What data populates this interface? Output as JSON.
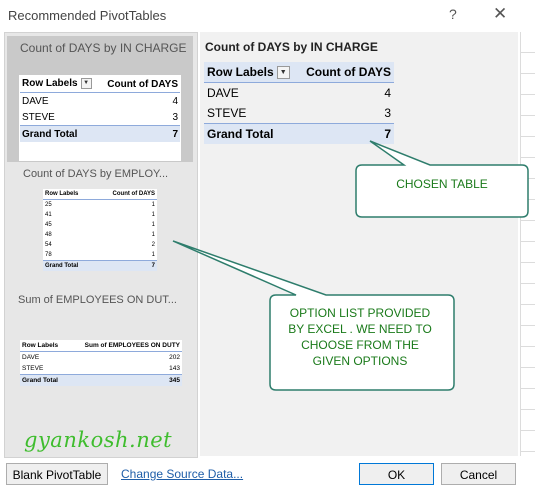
{
  "window": {
    "title": "Recommended PivotTables",
    "help": "?",
    "close": "✕"
  },
  "options": [
    {
      "title": "Count of DAYS by IN CHARGE",
      "headers": [
        "Row Labels",
        "Count of DAYS"
      ],
      "rows": [
        [
          "DAVE",
          "4"
        ],
        [
          "STEVE",
          "3"
        ]
      ],
      "total": [
        "Grand Total",
        "7"
      ]
    },
    {
      "title": "Count of DAYS by EMPLOY...",
      "headers": [
        "Row Labels",
        "Count of DAYS"
      ],
      "rows": [
        [
          "25",
          "1"
        ],
        [
          "41",
          "1"
        ],
        [
          "45",
          "1"
        ],
        [
          "48",
          "1"
        ],
        [
          "54",
          "2"
        ],
        [
          "78",
          "1"
        ]
      ],
      "total": [
        "Grand Total",
        "7"
      ]
    },
    {
      "title": "Sum of EMPLOYEES ON DUT...",
      "headers": [
        "Row Labels",
        "Sum of EMPLOYEES ON DUTY"
      ],
      "rows": [
        [
          "DAVE",
          "202"
        ],
        [
          "STEVE",
          "143"
        ]
      ],
      "total": [
        "Grand Total",
        "345"
      ]
    }
  ],
  "preview": {
    "title": "Count of DAYS by IN CHARGE",
    "headers": [
      "Row Labels",
      "Count of DAYS"
    ],
    "rows": [
      [
        "DAVE",
        "4"
      ],
      [
        "STEVE",
        "3"
      ]
    ],
    "total": [
      "Grand Total",
      "7"
    ]
  },
  "callouts": {
    "chosen": "CHOSEN TABLE",
    "options": [
      "OPTION LIST PROVIDED",
      "BY EXCEL . WE NEED TO",
      "CHOOSE FROM THE",
      "GIVEN OPTIONS"
    ]
  },
  "watermark": "gyankosh.net",
  "footer": {
    "blank_label": "Blank PivotTable",
    "change_source_label": "Change Source Data...",
    "ok_label": "OK",
    "cancel_label": "Cancel"
  },
  "colors": {
    "header_fill": "#dde6f4",
    "callout_fill": "#ffffff",
    "callout_border": "#2e7d6c",
    "callout_text": "#1a7a1a",
    "watermark": "#3fbd2e"
  }
}
